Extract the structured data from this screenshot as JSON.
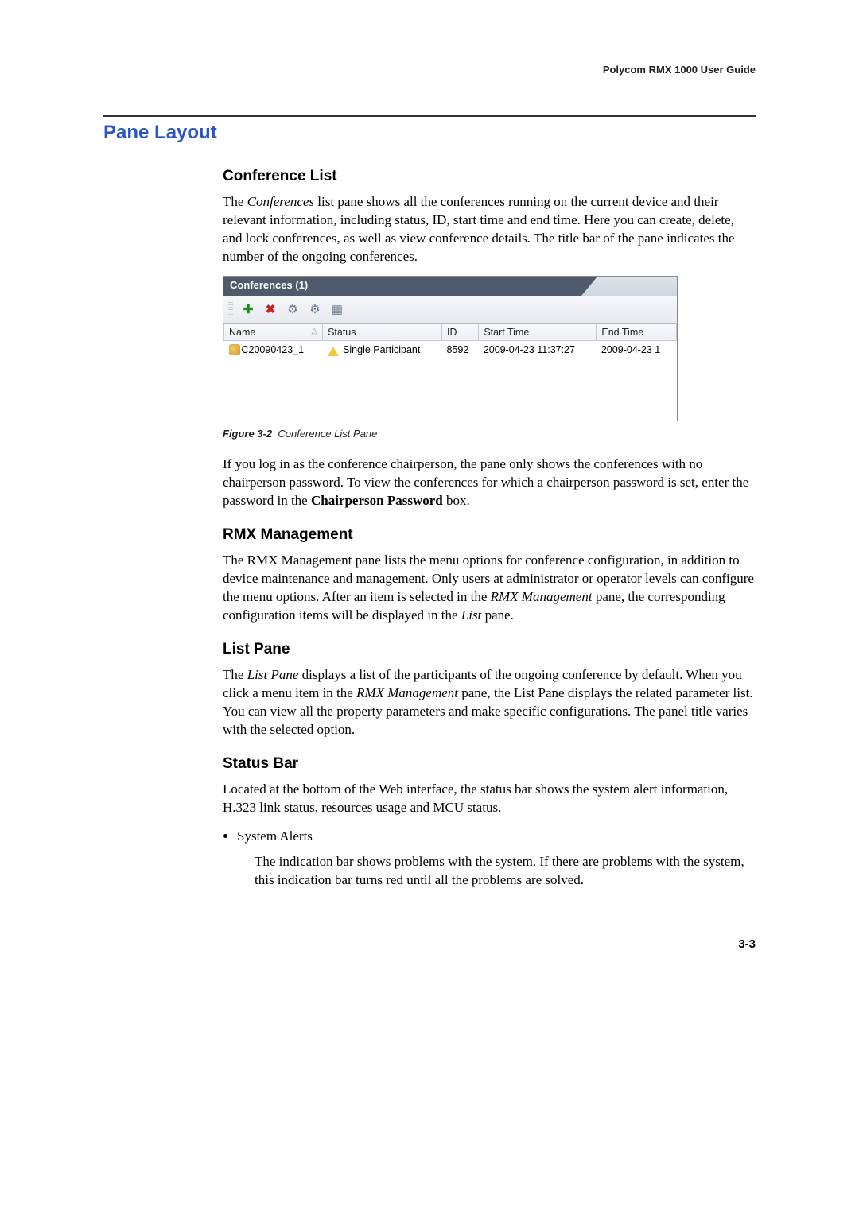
{
  "running_header": "Polycom RMX 1000 User Guide",
  "section_title": "Pane Layout",
  "conference_list": {
    "heading": "Conference List",
    "para_html": "The <span class='italic'>Conferences</span> list pane shows all the conferences running on the current device and their relevant information, including status, ID, start time and end time. Here you can create, delete, and lock conferences, as well as view conference details. The title bar of the pane indicates the number of the ongoing conferences."
  },
  "conf_pane": {
    "title": "Conferences (1)",
    "columns": [
      "Name",
      "Status",
      "ID",
      "Start Time",
      "End Time"
    ],
    "row": {
      "name": "C20090423_1",
      "status": "Single Participant",
      "id": "8592",
      "start": "2009-04-23 11:37:27",
      "end": "2009-04-23 1"
    }
  },
  "figure": {
    "label": "Figure 3-2",
    "text": "Conference List Pane"
  },
  "conf_para2_html": "If you log in as the conference chairperson, the pane only shows the conferences with no chairperson password. To view the conferences for which a chairperson password is set, enter the password in the <span class='bold'>Chairperson Password</span> box.",
  "rmx": {
    "heading": "RMX Management",
    "para_html": "The RMX Management pane lists the menu options for conference configuration, in addition to device maintenance and management. Only users at administrator or operator levels can configure the menu options. After an item is selected in the <span class='italic'>RMX Management</span> pane, the corresponding configuration items will be displayed in the <span class='italic'>List</span> pane."
  },
  "list_pane": {
    "heading": "List Pane",
    "para_html": "The <span class='italic'>List Pane</span> displays a list of the participants of the ongoing conference by default. When you click a menu item in the <span class='italic'>RMX Management</span> pane, the List Pane displays the related parameter list. You can view all the property parameters and make specific configurations. The panel title varies with the selected option."
  },
  "status_bar": {
    "heading": "Status Bar",
    "para": "Located at the bottom of the Web interface, the status bar shows the system alert information, H.323 link status, resources usage and MCU status.",
    "bullet": "System Alerts",
    "bullet_body": "The indication bar shows problems with the system. If there are problems with the system, this indication bar turns red until all the problems are solved."
  },
  "page_number": "3-3"
}
